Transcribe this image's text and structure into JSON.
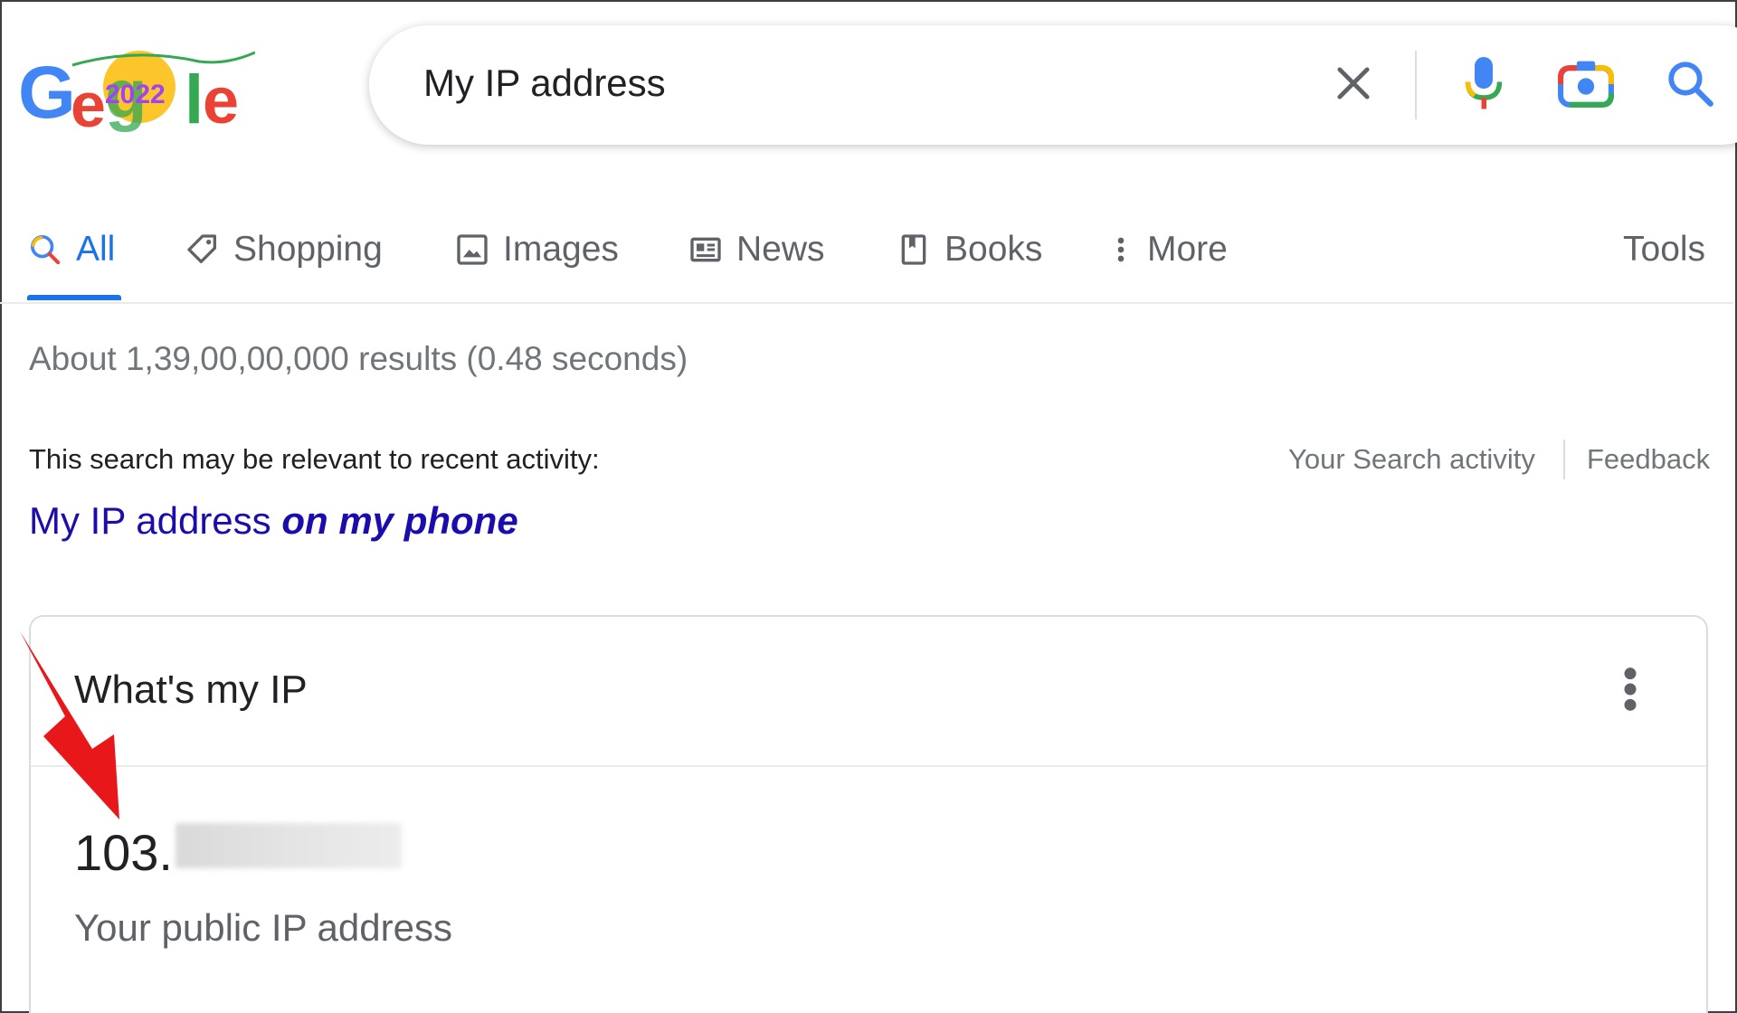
{
  "logo": {
    "alt": "Google",
    "doodle_year": "2022"
  },
  "search": {
    "query": "My IP address",
    "icons": [
      "close-icon",
      "microphone-icon",
      "camera-icon",
      "search-icon"
    ]
  },
  "tabs": [
    {
      "label": "All",
      "icon": "search-icon",
      "active": true
    },
    {
      "label": "Shopping",
      "icon": "tag-icon"
    },
    {
      "label": "Images",
      "icon": "image-icon"
    },
    {
      "label": "News",
      "icon": "newspaper-icon"
    },
    {
      "label": "Books",
      "icon": "book-icon"
    },
    {
      "label": "More",
      "icon": "kebab-icon"
    }
  ],
  "tools_label": "Tools",
  "results_stats": "About 1,39,00,00,000 results (0.48 seconds)",
  "relevance": {
    "notice": "This search may be relevant to recent activity:",
    "activity_link": "Your Search activity",
    "feedback_link": "Feedback",
    "suggestion_plain": "My IP address",
    "suggestion_bold": "on my phone"
  },
  "ip_card": {
    "title": "What's my IP",
    "ip_prefix": "103.",
    "caption": "Your public IP address"
  },
  "colors": {
    "accent": "#1a73e8",
    "link": "#1a0dab",
    "annotation_arrow": "#e8181a"
  }
}
